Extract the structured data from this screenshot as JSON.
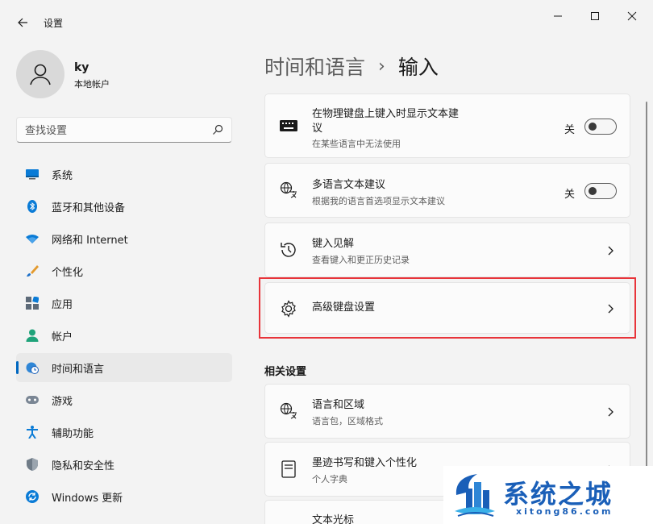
{
  "window": {
    "title": "设置"
  },
  "profile": {
    "name": "ky",
    "account_type": "本地帐户"
  },
  "search": {
    "placeholder": "查找设置"
  },
  "sidebar": {
    "items": [
      {
        "label": "系统",
        "icon": "system-icon"
      },
      {
        "label": "蓝牙和其他设备",
        "icon": "bluetooth-icon"
      },
      {
        "label": "网络和 Internet",
        "icon": "wifi-icon"
      },
      {
        "label": "个性化",
        "icon": "brush-icon"
      },
      {
        "label": "应用",
        "icon": "apps-icon"
      },
      {
        "label": "帐户",
        "icon": "account-icon"
      },
      {
        "label": "时间和语言",
        "icon": "globe-clock-icon",
        "active": true
      },
      {
        "label": "游戏",
        "icon": "gamepad-icon"
      },
      {
        "label": "辅助功能",
        "icon": "accessibility-icon"
      },
      {
        "label": "隐私和安全性",
        "icon": "shield-icon"
      },
      {
        "label": "Windows 更新",
        "icon": "update-icon"
      }
    ]
  },
  "breadcrumb": {
    "parent": "时间和语言",
    "separator": "›",
    "current": "输入"
  },
  "cards": [
    {
      "title": "在物理键盘上键入时显示文本建\n议",
      "subtitle": "在某些语言中无法使用",
      "toggle_label": "关",
      "toggle_on": false,
      "icon": "keyboard-icon"
    },
    {
      "title": "多语言文本建议",
      "subtitle": "根据我的语言首选项显示文本建议",
      "toggle_label": "关",
      "toggle_on": false,
      "icon": "language-icon"
    },
    {
      "title": "键入见解",
      "subtitle": "查看键入和更正历史记录",
      "icon": "history-icon"
    },
    {
      "title": "高级键盘设置",
      "icon": "gear-icon"
    }
  ],
  "related": {
    "title": "相关设置",
    "items": [
      {
        "title": "语言和区域",
        "subtitle": "语言包，区域格式",
        "icon": "language-icon"
      },
      {
        "title": "墨迹书写和键入个性化",
        "subtitle": "个人字典",
        "icon": "notebook-icon"
      },
      {
        "title": "文本光标"
      }
    ]
  },
  "watermark": {
    "text": "系统之城",
    "url": "xitong86.com"
  },
  "colors": {
    "accent": "#0067c0",
    "highlight_border": "#e8343a",
    "watermark_blue": "#1a5fb8"
  }
}
